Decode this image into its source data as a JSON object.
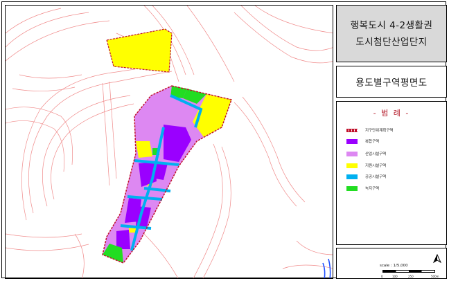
{
  "title": {
    "line1": "행복도시 4-2생활권",
    "line2": "도시첨단산업단지"
  },
  "subtitle": "용도별구역평면도",
  "legend": {
    "heading": "- 범 례 -",
    "items": [
      {
        "label": "지구단위계획구역",
        "kind": "boundary",
        "color": "#c0102a"
      },
      {
        "label": "복합구역",
        "kind": "fill",
        "color": "#9a00ff"
      },
      {
        "label": "산업시설구역",
        "kind": "fill",
        "color": "#dd88f2"
      },
      {
        "label": "지원시설구역",
        "kind": "fill",
        "color": "#ffff00"
      },
      {
        "label": "공공시설구역",
        "kind": "fill",
        "color": "#00b0f0"
      },
      {
        "label": "녹지구역",
        "kind": "fill",
        "color": "#22dd22"
      }
    ]
  },
  "scale": {
    "label": "scale : 1/5,000",
    "ticks": [
      "0",
      "100",
      "250",
      "500m"
    ]
  },
  "colors": {
    "base_road_lines": "#f08080",
    "panel_title_bg": "#d9d9d9"
  },
  "north_arrow_icon": "north-arrow-icon"
}
